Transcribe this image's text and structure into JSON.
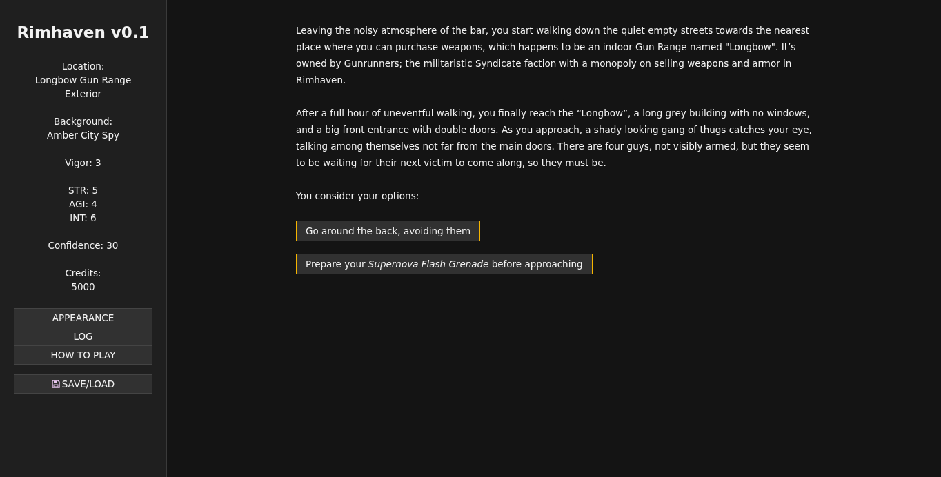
{
  "sidebar": {
    "title": "Rimhaven v0.1",
    "stat_groups": [
      [
        "Location:",
        "Longbow Gun Range",
        "Exterior"
      ],
      [
        "Background:",
        "Amber City Spy"
      ],
      [
        "Vigor: 3"
      ],
      [
        "STR: 5",
        "AGI: 4",
        "INT: 6"
      ],
      [
        "Confidence: 30"
      ],
      [
        "Credits:",
        "5000"
      ]
    ],
    "menu": [
      {
        "label": "APPEARANCE"
      },
      {
        "label": "LOG"
      },
      {
        "label": "HOW TO PLAY"
      }
    ],
    "save_button": {
      "label": "SAVE/LOAD"
    }
  },
  "story": {
    "paragraphs": [
      "Leaving the noisy atmosphere of the bar, you start walking down the quiet empty streets towards the nearest place where you can purchase weapons, which happens to be an indoor Gun Range named \"Longbow\". It’s owned by Gunrunners; the militaristic Syndicate faction with a monopoly on selling weapons and armor in Rimhaven.",
      "After a full hour of uneventful walking, you finally reach the “Longbow”, a long grey building with no windows, and a big front entrance with double doors. As you approach, a shady looking gang of thugs catches your eye, talking among themselves not far from the main doors. There are four guys, not visibly armed, but they seem to be waiting for their next victim to come along, so they must be.",
      "You consider your options:"
    ],
    "choices": [
      "Go around the back, avoiding them",
      "Prepare your *Supernova Flash Grenade* before approaching"
    ]
  }
}
